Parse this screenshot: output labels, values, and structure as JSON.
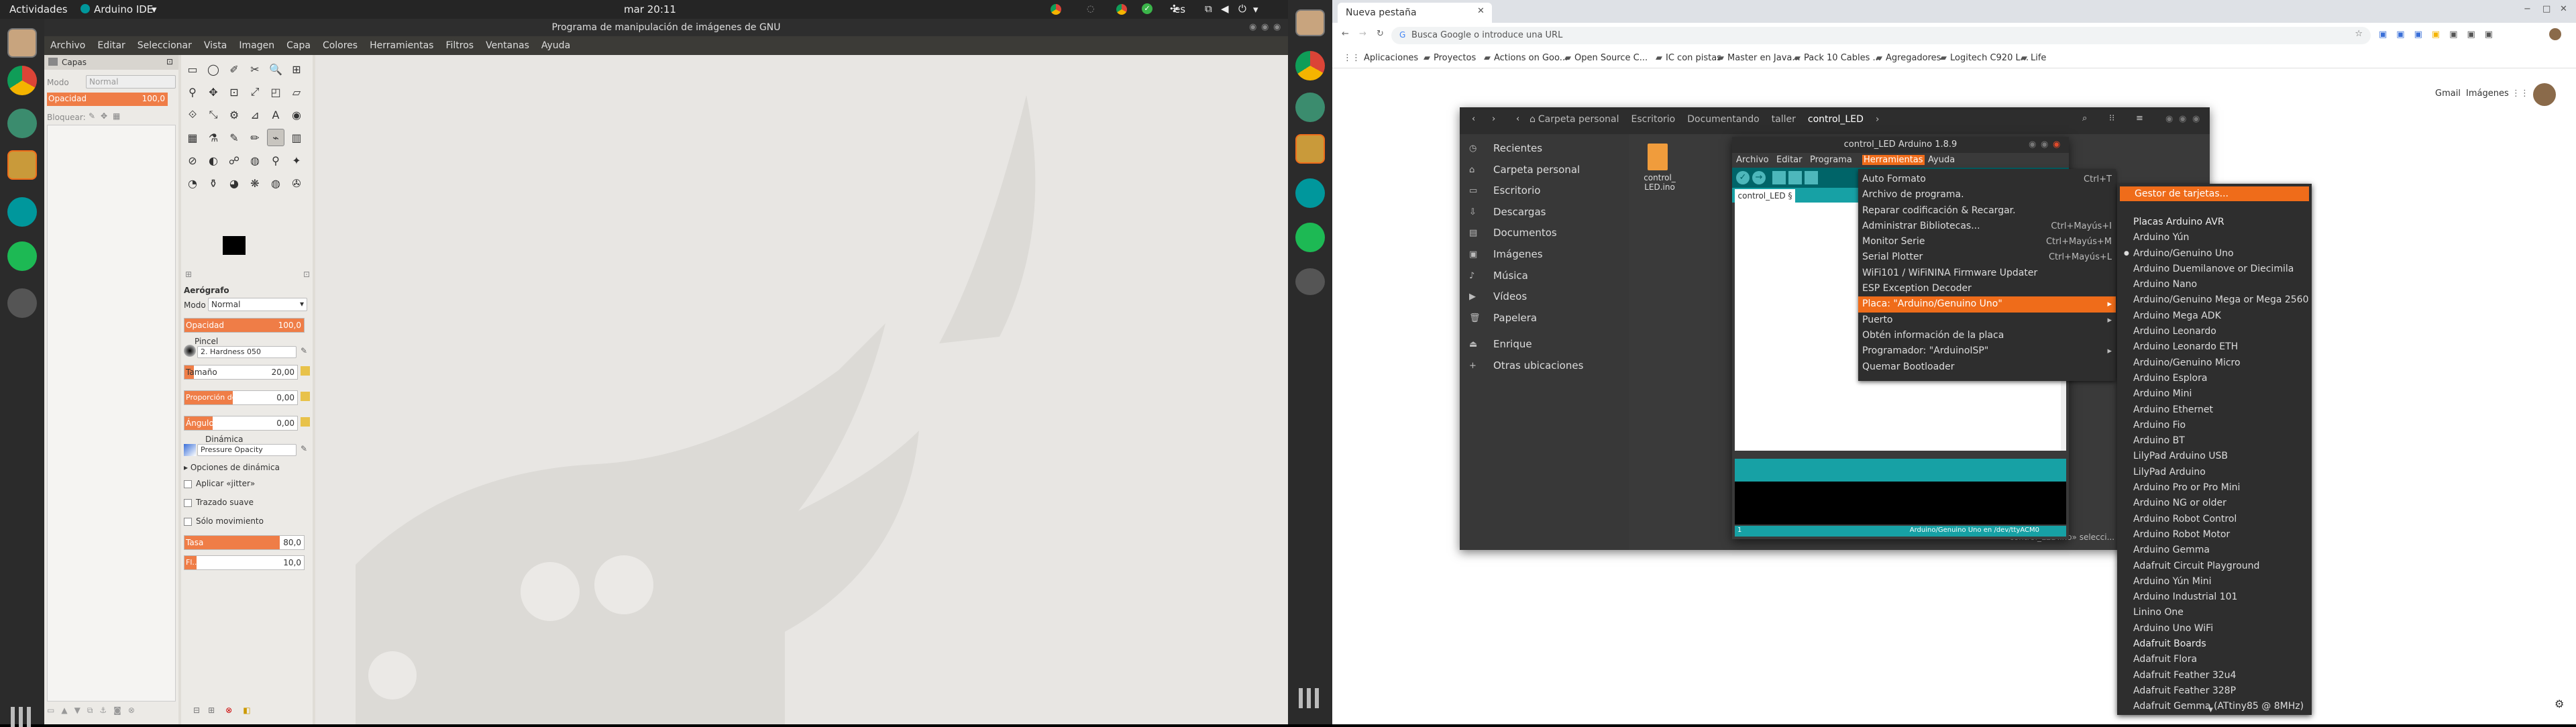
{
  "topbar": {
    "activities": "Actividades",
    "app_name": "Arduino IDE",
    "app_arrow": "▾",
    "datetime": "mar 20:11",
    "language": "es",
    "power_arrow": "▾"
  },
  "gimp": {
    "title": "Programa de manipulación de imágenes de GNU",
    "menu": [
      "Archivo",
      "Editar",
      "Seleccionar",
      "Vista",
      "Imagen",
      "Capa",
      "Colores",
      "Herramientas",
      "Filtros",
      "Ventanas",
      "Ayuda"
    ],
    "layers": {
      "tab": "Capas",
      "mode_label": "Modo",
      "mode_value": "Normal",
      "opacity_label": "Opacidad",
      "opacity_value": "100,0",
      "lock_label": "Bloquear:"
    },
    "tool_options": {
      "title": "Aerógrafo",
      "mode_label": "Modo",
      "mode_value": "Normal",
      "opacity_label": "Opacidad",
      "opacity_value": "100,0",
      "opacity_fraction": 1.0,
      "brush_label": "Pincel",
      "brush_value": "2. Hardness 050",
      "size_label": "Tamaño",
      "size_value": "20,00",
      "ratio_label": "Proporción de ...",
      "ratio_value": "0,00",
      "angle_label": "Ángulo",
      "angle_value": "0,00",
      "dynamics_label": "Dinámica",
      "dynamics_value": "Pressure Opacity",
      "dynamics_options": "Opciones de dinámica",
      "jitter": "Aplicar «jitter»",
      "smooth": "Trazado suave",
      "motion_only": "Sólo movimiento",
      "rate_label": "Tasa",
      "rate_value": "80,0",
      "rate_fraction": 0.8,
      "flow_label": "Fl...",
      "flow_value": "10,0",
      "flow_fraction": 0.1
    }
  },
  "chrome": {
    "tab_title": "Nueva pestaña",
    "address_placeholder": "Busca Google o introduce una URL",
    "bookmarks": [
      "Aplicaciones",
      "Proyectos",
      "Actions on Goo...",
      "Open Source C...",
      "IC con pistas",
      "Master en Java...",
      "Pack 10 Cables ...",
      "Agregadores",
      "Logitech C920 L...",
      "Life"
    ],
    "gmail": "Gmail",
    "images": "Imágenes"
  },
  "nautilus": {
    "path": [
      "Carpeta personal",
      "Escritorio",
      "Documentando",
      "taller",
      "control_LED"
    ],
    "sidebar": [
      "Recientes",
      "Carpeta personal",
      "Escritorio",
      "Descargas",
      "Documentos",
      "Imágenes",
      "Música",
      "Vídeos",
      "Papelera",
      "Enrique",
      "Otras ubicaciones"
    ],
    "file_name": "control_\nLED.ino"
  },
  "arduino": {
    "title": "control_LED Arduino 1.8.9",
    "menu": [
      "Archivo",
      "Editar",
      "Programa",
      "Herramientas",
      "Ayuda"
    ],
    "tab": "control_LED §",
    "status_line": "1",
    "status_board": "Arduino/Genuino Uno en /dev/ttyACM0",
    "behind_text": "«control_LED.ino» selecci..."
  },
  "tools_menu": [
    {
      "label": "Auto Formato",
      "shortcut": "Ctrl+T"
    },
    {
      "label": "Archivo de programa.",
      "shortcut": ""
    },
    {
      "label": "Reparar codificación & Recargar.",
      "shortcut": ""
    },
    {
      "label": "Administrar Bibliotecas...",
      "shortcut": "Ctrl+Mayús+I"
    },
    {
      "label": "Monitor Serie",
      "shortcut": "Ctrl+Mayús+M"
    },
    {
      "label": "Serial Plotter",
      "shortcut": "Ctrl+Mayús+L"
    },
    {
      "label": "WiFi101 / WiFiNINA Firmware Updater",
      "shortcut": ""
    },
    {
      "label": "ESP Exception Decoder",
      "shortcut": ""
    },
    {
      "label": "Placa: \"Arduino/Genuino Uno\"",
      "shortcut": "▸",
      "selected": true
    },
    {
      "label": "Puerto",
      "shortcut": "▸"
    },
    {
      "label": "Obtén información de la placa",
      "shortcut": ""
    },
    {
      "label": "Programador: \"ArduinoISP\"",
      "shortcut": "▸"
    },
    {
      "label": "Quemar Bootloader",
      "shortcut": ""
    }
  ],
  "boards_menu": {
    "first": "Gestor de tarjetas...",
    "items": [
      {
        "label": "Placas Arduino AVR",
        "header": true
      },
      {
        "label": "Arduino Yún"
      },
      {
        "label": "Arduino/Genuino Uno",
        "checked": true
      },
      {
        "label": "Arduino Duemilanove or Diecimila"
      },
      {
        "label": "Arduino Nano"
      },
      {
        "label": "Arduino/Genuino Mega or Mega 2560"
      },
      {
        "label": "Arduino Mega ADK"
      },
      {
        "label": "Arduino Leonardo"
      },
      {
        "label": "Arduino Leonardo ETH"
      },
      {
        "label": "Arduino/Genuino Micro"
      },
      {
        "label": "Arduino Esplora"
      },
      {
        "label": "Arduino Mini"
      },
      {
        "label": "Arduino Ethernet"
      },
      {
        "label": "Arduino Fio"
      },
      {
        "label": "Arduino BT"
      },
      {
        "label": "LilyPad Arduino USB"
      },
      {
        "label": "LilyPad Arduino"
      },
      {
        "label": "Arduino Pro or Pro Mini"
      },
      {
        "label": "Arduino NG or older"
      },
      {
        "label": "Arduino Robot Control"
      },
      {
        "label": "Arduino Robot Motor"
      },
      {
        "label": "Arduino Gemma"
      },
      {
        "label": "Adafruit Circuit Playground"
      },
      {
        "label": "Arduino Yún Mini"
      },
      {
        "label": "Arduino Industrial 101"
      },
      {
        "label": "Linino One"
      },
      {
        "label": "Arduino Uno WiFi"
      },
      {
        "label": "Adafruit Boards",
        "header": true
      },
      {
        "label": "Adafruit Flora"
      },
      {
        "label": "Adafruit Feather 32u4"
      },
      {
        "label": "Adafruit Feather 328P"
      },
      {
        "label": "Adafruit Gemma (ATtiny85 @ 8MHz)"
      }
    ],
    "scroll_arrow": "▼"
  },
  "colors": {
    "accent": "#ef7d47",
    "ubuntu_orange": "#ef6c1a",
    "arduino_teal": "#00979c"
  }
}
